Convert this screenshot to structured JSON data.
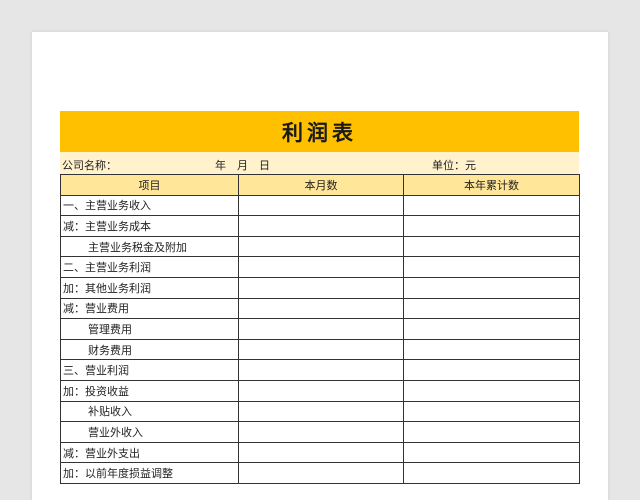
{
  "title": "利润表",
  "info": {
    "company": "公司名称：",
    "date": "年　月　日",
    "unit": "单位：元"
  },
  "headers": [
    "项目",
    "本月数",
    "本年累计数"
  ],
  "rows": [
    {
      "label": "一、主营业务收入",
      "indent": false
    },
    {
      "label": "减：主营业务成本",
      "indent": false
    },
    {
      "label": "主营业务税金及附加",
      "indent": true
    },
    {
      "label": "二、主营业务利润",
      "indent": false
    },
    {
      "label": "加：其他业务利润",
      "indent": false
    },
    {
      "label": "减：营业费用",
      "indent": false
    },
    {
      "label": "管理费用",
      "indent": true
    },
    {
      "label": "财务费用",
      "indent": true
    },
    {
      "label": "三、营业利润",
      "indent": false
    },
    {
      "label": "加：投资收益",
      "indent": false
    },
    {
      "label": "补贴收入",
      "indent": true
    },
    {
      "label": "营业外收入",
      "indent": true
    },
    {
      "label": "减：营业外支出",
      "indent": false
    },
    {
      "label": "加：以前年度损益调整",
      "indent": false
    }
  ],
  "colors": {
    "title_bg": "#ffc000",
    "info_bg": "#fff2cc",
    "header_bg": "#ffe699",
    "background": "#e6e6e6"
  }
}
